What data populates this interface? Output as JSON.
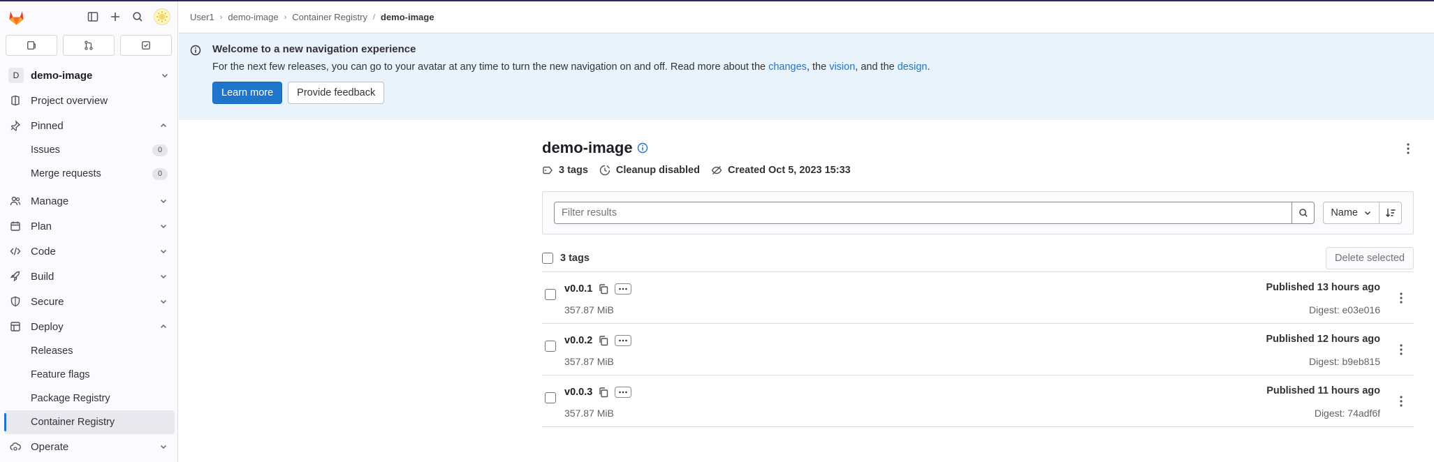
{
  "sidebar": {
    "project_initial": "D",
    "project_name": "demo-image",
    "project_overview": "Project overview",
    "pinned": "Pinned",
    "issues": "Issues",
    "issues_count": "0",
    "merge_requests": "Merge requests",
    "merge_requests_count": "0",
    "manage": "Manage",
    "plan": "Plan",
    "code": "Code",
    "build": "Build",
    "secure": "Secure",
    "deploy": "Deploy",
    "releases": "Releases",
    "feature_flags": "Feature flags",
    "package_registry": "Package Registry",
    "container_registry": "Container Registry",
    "operate": "Operate"
  },
  "breadcrumb": {
    "items": [
      "User1",
      "demo-image",
      "Container Registry"
    ],
    "current": "demo-image"
  },
  "banner": {
    "title": "Welcome to a new navigation experience",
    "text_1": "For the next few releases, you can go to your avatar at any time to turn the new navigation on and off. Read more about the ",
    "link_changes": "changes",
    "text_2": ", the ",
    "link_vision": "vision",
    "text_3": ", and the ",
    "link_design": "design",
    "text_4": ".",
    "learn_more": "Learn more",
    "feedback": "Provide feedback"
  },
  "page": {
    "title": "demo-image",
    "tags_count": "3 tags",
    "cleanup": "Cleanup disabled",
    "created": "Created Oct 5, 2023 15:33"
  },
  "filter": {
    "placeholder": "Filter results",
    "sort_label": "Name"
  },
  "list": {
    "header_label": "3 tags",
    "delete_selected": "Delete selected",
    "tags": [
      {
        "name": "v0.0.1",
        "size": "357.87 MiB",
        "published": "Published 13 hours ago",
        "digest": "Digest: e03e016"
      },
      {
        "name": "v0.0.2",
        "size": "357.87 MiB",
        "published": "Published 12 hours ago",
        "digest": "Digest: b9eb815"
      },
      {
        "name": "v0.0.3",
        "size": "357.87 MiB",
        "published": "Published 11 hours ago",
        "digest": "Digest: 74adf6f"
      }
    ]
  },
  "colors": {
    "accent": "#1f75cb",
    "banner_bg": "#e9f3fc",
    "logo_orange": "#e24329"
  }
}
